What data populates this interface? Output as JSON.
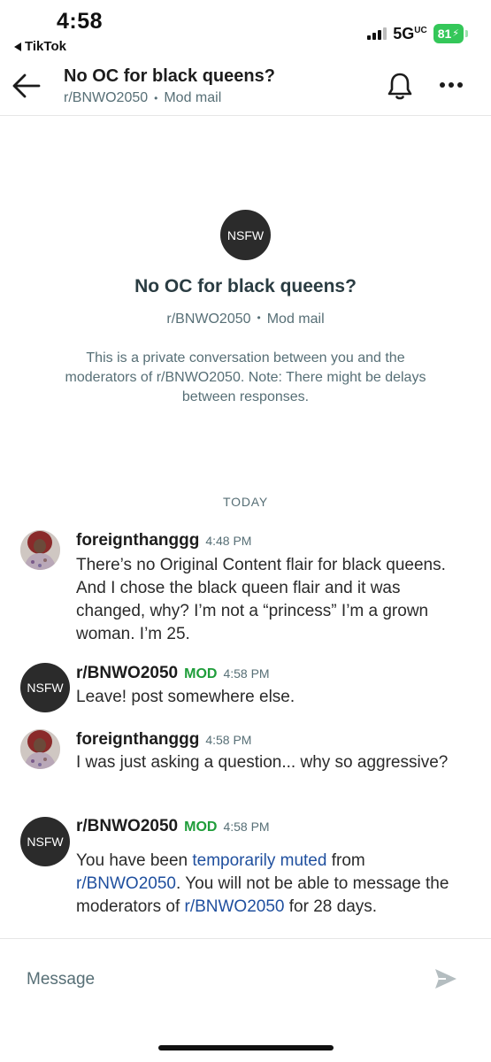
{
  "status_bar": {
    "time": "4:58",
    "back_app": "TikTok",
    "network": "5G",
    "network_sup": "UC",
    "battery": "81"
  },
  "header": {
    "title": "No OC for black queens?",
    "subreddit": "r/BNWO2050",
    "type": "Mod mail",
    "icons": [
      "back-arrow-icon",
      "bell-icon",
      "more-icon"
    ]
  },
  "intro": {
    "avatar_label": "NSFW",
    "title": "No OC for black queens?",
    "subreddit": "r/BNWO2050",
    "type": "Mod mail",
    "description": "This is a private conversation between you and the moderators of r/BNWO2050. Note: There might be delays between responses."
  },
  "day_separator": "TODAY",
  "messages": [
    {
      "author": "foreignthanggg",
      "time": "4:48 PM",
      "body": "There’s no Original Content flair for black queens. And I chose the black queen flair and it was changed, why? I’m not a “princess” I’m a grown woman. I’m 25."
    },
    {
      "author": "r/BNWO2050",
      "avatar_label": "NSFW",
      "mod_tag": "MOD",
      "time": "4:58 PM",
      "body": "Leave! post somewhere else."
    },
    {
      "author": "foreignthanggg",
      "time": "4:58 PM",
      "body": "I was just asking a question... why so aggressive?"
    },
    {
      "author": "r/BNWO2050",
      "avatar_label": "NSFW",
      "mod_tag": "MOD",
      "time": "4:58 PM",
      "body_part1": "You have been ",
      "body_link1": "temporarily muted",
      "body_part2": " from ",
      "body_link2": "r/BNWO2050",
      "body_part3": ". You will not be able to message the moderators of ",
      "body_link3": "r/BNWO2050",
      "body_part4": " for 28 days."
    }
  ],
  "composer": {
    "placeholder": "Message",
    "send_icon": "send-icon"
  },
  "colors": {
    "mod_green": "#1f9d3a",
    "link_blue": "#1f4f9e",
    "muted_text": "#576f76",
    "battery_green": "#34c759"
  }
}
